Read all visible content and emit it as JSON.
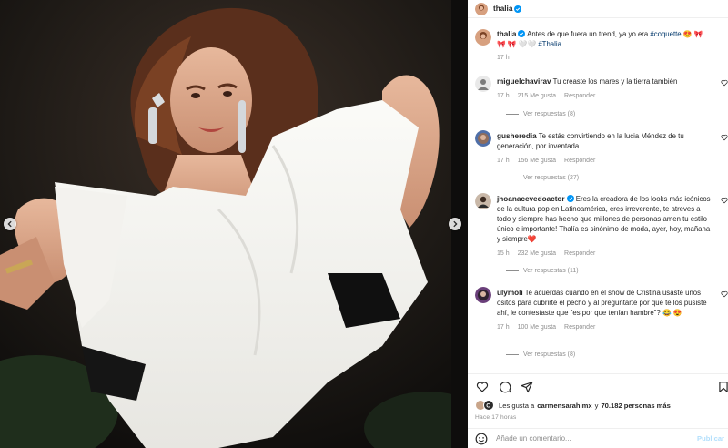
{
  "post": {
    "author": "thalia",
    "caption_time": "17 h",
    "caption": {
      "text": "Antes de que fuera un trend, ya yo era",
      "hashtag1": "#coquette",
      "emojis1": "😍 🎀",
      "emojis2": "🎀 🎀 🤍🤍",
      "hashtag2": "#Thalia"
    }
  },
  "comments": [
    {
      "user": "miguelchavirav",
      "text": "Tu creaste los mares y la tierra también",
      "time": "17 h",
      "likes": "215 Me gusta",
      "reply": "Responder",
      "replies": "Ver respuestas (8)"
    },
    {
      "user": "gusheredia",
      "text": "Te estás convirtiendo en la lucia Méndez de tu generación, por inventada.",
      "time": "17 h",
      "likes": "156 Me gusta",
      "reply": "Responder",
      "replies": "Ver respuestas (27)"
    },
    {
      "user": "jhoanacevedoactor",
      "text": "Eres la creadora de los looks más icónicos de la cultura pop en Latinoamérica, eres irreverente, te atreves a todo y siempre has hecho que millones de personas amen tu estilo único e importante! Thalía es sinónimo de moda, ayer, hoy, mañana y siempre❤️",
      "time": "15 h",
      "likes": "232 Me gusta",
      "reply": "Responder",
      "replies": "Ver respuestas (11)"
    },
    {
      "user": "ulymoli",
      "text": "Te acuerdas cuando en el show de Cristina usaste unos ositos para cubrirte el pecho y al preguntarte por que te los pusiste ahí, le contestaste que \"es por que tenían hambre\"? 😂 😍",
      "time": "17 h",
      "likes": "100 Me gusta",
      "reply": "Responder",
      "replies": "Ver respuestas (8)"
    }
  ],
  "likes": {
    "prefix": "Les gusta a",
    "user": "carmensarahimx",
    "middle": "y",
    "count": "70.182 personas más"
  },
  "posted": "Hace 17 horas",
  "add_comment": {
    "placeholder": "Añade un comentario...",
    "publish": "Publicar"
  },
  "colors": {
    "link": "#00376b",
    "muted": "#8e8e8e",
    "verified": "#0095f6",
    "publish_disabled": "#b2dffc"
  },
  "icons": [
    "chevron-left-icon",
    "chevron-right-icon",
    "verified-icon",
    "heart-icon",
    "comment-icon",
    "share-icon",
    "bookmark-icon",
    "emoji-icon"
  ]
}
